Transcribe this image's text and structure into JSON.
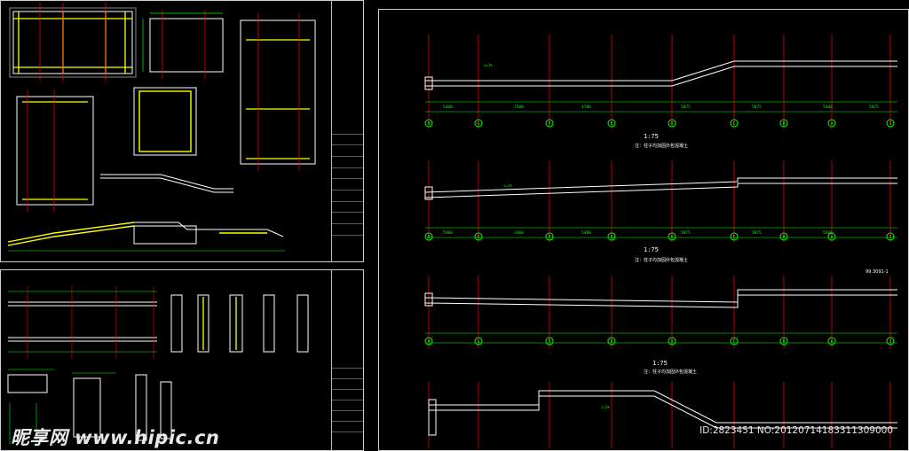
{
  "watermark": {
    "text": "昵享网 www.hipic.cn",
    "id_line": "ID:2823451 NO:20120714183311309000"
  },
  "right_sheet": {
    "scales": [
      "1:75",
      "1:75",
      "1:75"
    ],
    "notes": [
      "注：柱子均加固外包混凝土",
      "注：柱子均加固外包混凝土",
      "注：柱子均加固外包混凝土"
    ],
    "axis_labels": [
      "H",
      "G",
      "F",
      "E",
      "D",
      "C",
      "B",
      "A",
      "J",
      "K"
    ],
    "dims_row1": [
      "5400",
      "7500",
      "4700",
      "5875",
      "5875",
      "5400",
      "5875"
    ],
    "dims_row2": [
      "5400",
      "3400",
      "5400",
      "5875",
      "5875",
      "5400"
    ],
    "section_tag": "99.3091-1",
    "slope_tags": [
      "i=1%",
      "i=1%",
      "i=3%"
    ]
  },
  "colors": {
    "background": "#000000",
    "structure": "#ffffff",
    "dimension": "#00ff00",
    "elevation_text": "#00ff00",
    "axis": "#ff0000",
    "highlight": "#ffff00",
    "outline": "#cfcfcf",
    "blue_label": "#3a7bff"
  }
}
